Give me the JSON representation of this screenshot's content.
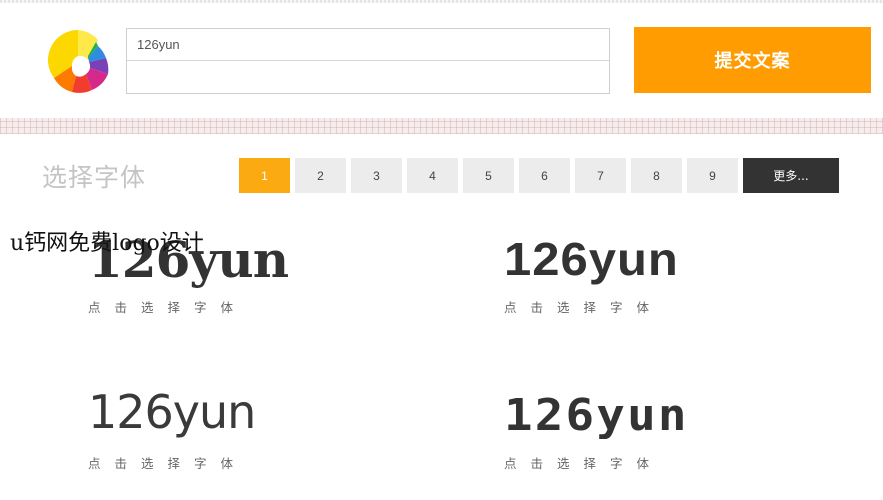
{
  "header": {
    "text_input_value": "126yun",
    "text_input_placeholder": "",
    "second_input_value": "",
    "submit_label": "提交文案"
  },
  "font_section": {
    "title": "选择字体",
    "pages": [
      "1",
      "2",
      "3",
      "4",
      "5",
      "6",
      "7",
      "8",
      "9"
    ],
    "active_page": "1",
    "more_label": "更多..."
  },
  "font_cards": [
    {
      "sample": "126yun",
      "caption": "点击选择字体"
    },
    {
      "sample": "126yun",
      "caption": "点击选择字体"
    },
    {
      "sample": "126yun",
      "caption": "点击选择字体"
    },
    {
      "sample": "126yun",
      "caption": "点击选择字体"
    }
  ],
  "watermark": "u钙网免费logo设计",
  "colors": {
    "accent_orange": "#fe9c01",
    "page_active": "#fbab11",
    "more_button": "#333333"
  }
}
